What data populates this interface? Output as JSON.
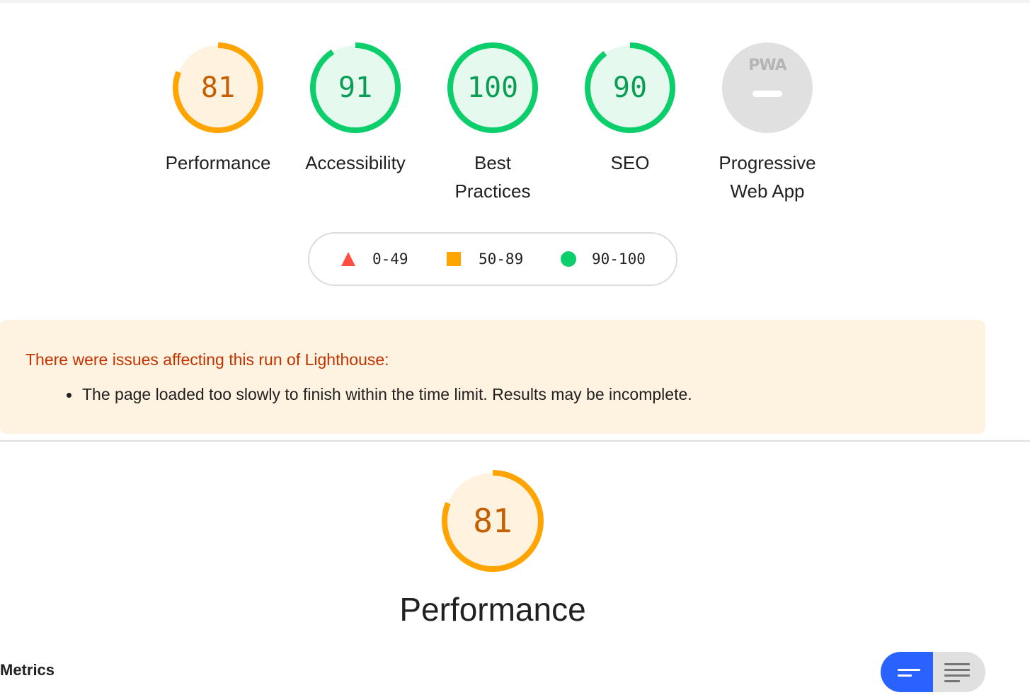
{
  "categories": [
    {
      "key": "performance",
      "score": "81",
      "label": "Performance",
      "fraction": 0.81,
      "status": "average"
    },
    {
      "key": "accessibility",
      "score": "91",
      "label": "Accessibility",
      "fraction": 0.91,
      "status": "pass"
    },
    {
      "key": "best_practices",
      "score": "100",
      "label_line1": "Best",
      "label_line2": "Practices",
      "fraction": 1.0,
      "status": "pass"
    },
    {
      "key": "seo",
      "score": "90",
      "label": "SEO",
      "fraction": 0.9,
      "status": "pass"
    },
    {
      "key": "pwa",
      "badge": "PWA",
      "label_line1": "Progressive",
      "label_line2": "Web App",
      "status": "na"
    }
  ],
  "legend": {
    "fail": "0-49",
    "average": "50-89",
    "pass": "90-100"
  },
  "warning": {
    "title": "There were issues affecting this run of Lighthouse:",
    "items": [
      "The page loaded too slowly to finish within the time limit. Results may be incomplete."
    ]
  },
  "performance_section": {
    "score": "81",
    "fraction": 0.81,
    "title": "Performance"
  },
  "metrics": {
    "label": "Metrics"
  },
  "colors": {
    "fail": "#ff4e42",
    "average": "#ffa400",
    "average_bg": "#fff3e0",
    "pass": "#0cce6b",
    "pass_text": "#008800",
    "pass_bg": "#e6f9ee",
    "toggle_active": "#2962ff"
  }
}
